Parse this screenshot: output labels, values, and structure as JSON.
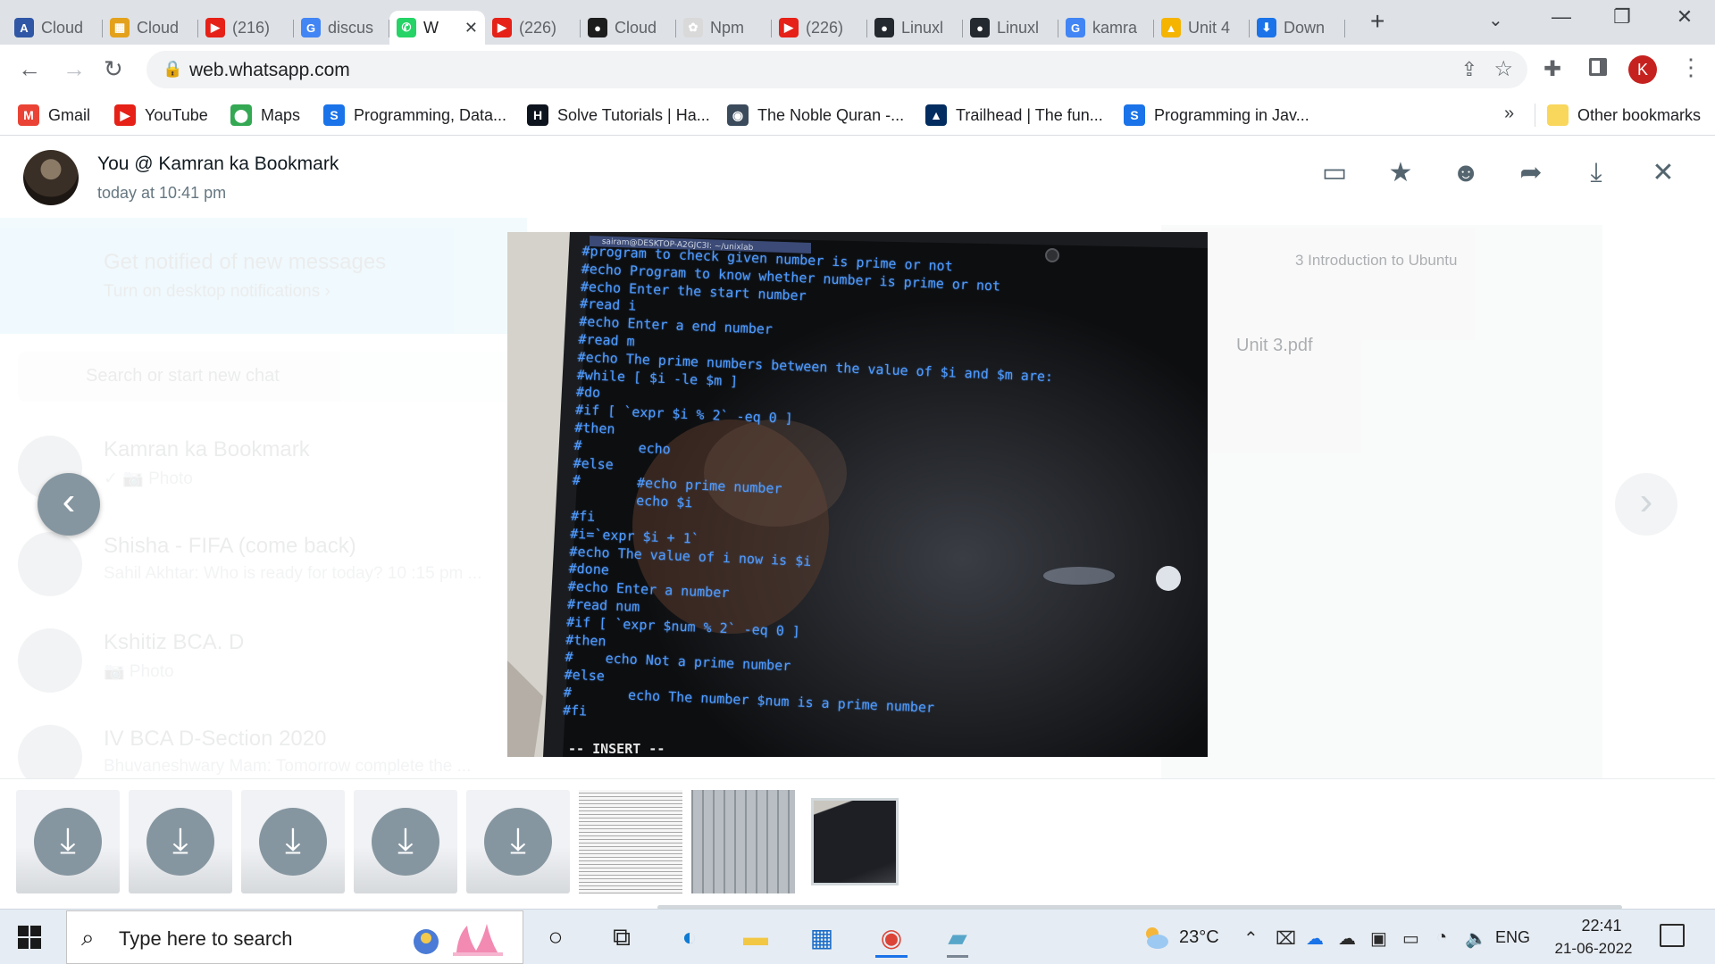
{
  "browser": {
    "tabs": [
      {
        "title": "Cloud",
        "icon": "cloud-app-icon",
        "color": "#2f57a6",
        "glyph": "A"
      },
      {
        "title": "Cloud",
        "icon": "cloud-stack-icon",
        "color": "#e4a11b",
        "glyph": "▦"
      },
      {
        "title": "(216)",
        "icon": "youtube-icon",
        "color": "#e62117",
        "glyph": "▶"
      },
      {
        "title": "discus",
        "icon": "google-icon",
        "color": "#4285f4",
        "glyph": "G"
      },
      {
        "title": "W",
        "icon": "whatsapp-icon",
        "color": "#25d366",
        "glyph": "✆",
        "active": true
      },
      {
        "title": "(226)",
        "icon": "youtube-icon",
        "color": "#e62117",
        "glyph": "▶"
      },
      {
        "title": "Cloud",
        "icon": "cloud-leaf-icon",
        "color": "#1d1d1d",
        "glyph": "●"
      },
      {
        "title": "Npm",
        "icon": "npm-icon",
        "color": "#d9d9d9",
        "glyph": "✿"
      },
      {
        "title": "(226)",
        "icon": "youtube-icon",
        "color": "#e62117",
        "glyph": "▶"
      },
      {
        "title": "Linuxl",
        "icon": "github-icon",
        "color": "#24292f",
        "glyph": "●"
      },
      {
        "title": "Linuxl",
        "icon": "github-icon",
        "color": "#24292f",
        "glyph": "●"
      },
      {
        "title": "kamra",
        "icon": "google-icon",
        "color": "#4285f4",
        "glyph": "G"
      },
      {
        "title": "Unit 4",
        "icon": "google-drive-icon",
        "color": "#f4b400",
        "glyph": "▲"
      },
      {
        "title": "Down",
        "icon": "download-icon",
        "color": "#1a73e8",
        "glyph": "⬇"
      }
    ],
    "new_tab": "+",
    "url": "web.whatsapp.com",
    "profile_initial": "K",
    "bookmarks": [
      {
        "label": "Gmail",
        "icon": "gmail-icon",
        "color": "#ea4335",
        "glyph": "M"
      },
      {
        "label": "YouTube",
        "icon": "youtube-icon",
        "color": "#e62117",
        "glyph": "▶"
      },
      {
        "label": "Maps",
        "icon": "maps-pin-icon",
        "color": "#34a853",
        "glyph": "⬤"
      },
      {
        "label": "Programming, Data...",
        "icon": "scaler-s-icon",
        "color": "#1a73e8",
        "glyph": "S"
      },
      {
        "label": "Solve Tutorials | Ha...",
        "icon": "hackerrank-icon",
        "color": "#0e141e",
        "glyph": "H"
      },
      {
        "label": "The Noble Quran -...",
        "icon": "quran-icon",
        "color": "#3b4b5c",
        "glyph": "◉"
      },
      {
        "label": "Trailhead | The fun...",
        "icon": "trailhead-icon",
        "color": "#032d60",
        "glyph": "▲"
      },
      {
        "label": "Programming in Jav...",
        "icon": "scaler-s-icon",
        "color": "#1a73e8",
        "glyph": "S"
      }
    ],
    "more_bookmarks": "»",
    "other_bookmarks": "Other bookmarks"
  },
  "viewer": {
    "sender": "You @ Kamran ka Bookmark",
    "time": "today at 10:41 pm",
    "actions": [
      {
        "name": "reply-icon",
        "glyph": "▭"
      },
      {
        "name": "star-icon",
        "glyph": "★"
      },
      {
        "name": "emoji-icon",
        "glyph": "☻"
      },
      {
        "name": "forward-icon",
        "glyph": "➦"
      },
      {
        "name": "download-icon",
        "glyph": "⤓"
      },
      {
        "name": "close-icon",
        "glyph": "✕"
      }
    ],
    "photo": {
      "titlebar": "sairam@DESKTOP-A2GJC3I: ~/unixlab",
      "code_lines": [
        "#program to check given number is prime or not",
        "#echo Program to know whether number is prime or not",
        "#echo Enter the start number",
        "#read i",
        "#echo Enter a end number",
        "#read m",
        "#echo The prime numbers between the value of $i and $m are:",
        "#while [ $i -le $m ]",
        "#do",
        "#if [ `expr $i % 2` -eq 0 ]",
        "#then",
        "#       echo",
        "#else",
        "#       #echo prime number",
        "        echo $i",
        "#fi",
        "#i=`expr $i + 1`",
        "#echo The value of i now is $i",
        "#done",
        "#echo Enter a number",
        "#read num",
        "#if [ `expr $num % 2` -eq 0 ]",
        "#then",
        "#    echo Not a prime number",
        "#else",
        "#       echo The number $num is a prime number",
        "#fi"
      ],
      "mode": "-- INSERT --"
    },
    "prev": "‹",
    "next": "›"
  },
  "background_chats": {
    "notify_title": "Get notified of new messages",
    "notify_sub": "Turn on desktop notifications ›",
    "search_placeholder": "Search or start new chat",
    "chats": [
      {
        "name": "Kamran ka Bookmark",
        "msg": "✓ 📷 Photo"
      },
      {
        "name": "Shisha - FIFA (come back)",
        "msg": "Sahil Akhtar: Who is ready for today? 10 :15 pm ..."
      },
      {
        "name": "Kshitiz BCA. D",
        "msg": "📷 Photo"
      },
      {
        "name": "IV BCA D-Section 2020",
        "msg": "Bhuvaneshwary Mam: Tomorrow complete the ..."
      }
    ],
    "doc_title": "3 Introduction to Ubuntu",
    "doc_file": "Unit 3.pdf"
  },
  "thumbnails": {
    "download_glyph": "⤓",
    "download_count": 5,
    "image_thumbs": [
      "thumb-table-1",
      "thumb-table-2",
      "thumb-current"
    ]
  },
  "taskbar": {
    "search_placeholder": "Type here to search",
    "apps": [
      {
        "name": "cortana-icon",
        "glyph": "○"
      },
      {
        "name": "task-view-icon",
        "glyph": "⧉"
      },
      {
        "name": "edge-icon",
        "glyph": "◐",
        "color": "#0f7bd3"
      },
      {
        "name": "file-explorer-icon",
        "glyph": "▬",
        "color": "#f2c744"
      },
      {
        "name": "store-icon",
        "glyph": "▦",
        "color": "#1a6cc7"
      },
      {
        "name": "chrome-icon",
        "glyph": "◉",
        "color": "#db4437",
        "active": true
      },
      {
        "name": "notepad-icon",
        "glyph": "▰",
        "color": "#57a6c9",
        "open": true
      }
    ],
    "temperature": "23°C",
    "language": "ENG",
    "time": "22:41",
    "date": "21-06-2022"
  }
}
